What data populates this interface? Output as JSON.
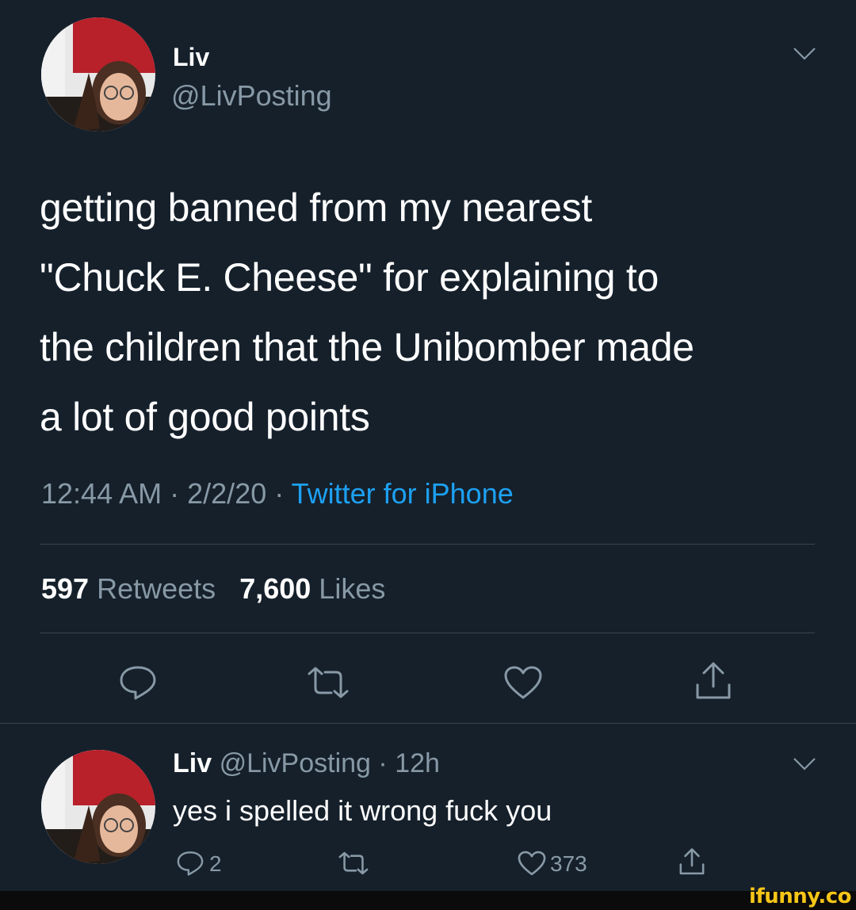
{
  "tweet": {
    "display_name": "Liv",
    "handle": "@LivPosting",
    "text_lines": [
      "getting banned from my nearest",
      "\"Chuck E. Cheese\" for explaining to",
      "the children that the Unibomber made",
      "a lot of good points"
    ],
    "time": "12:44 AM",
    "date": "2/2/20",
    "separator": "·",
    "source": "Twitter for iPhone",
    "retweets_count": "597",
    "retweets_label": "Retweets",
    "likes_count": "7,600",
    "likes_label": "Likes"
  },
  "reply": {
    "display_name": "Liv",
    "handle": "@LivPosting",
    "age": "· 12h",
    "text": "yes i spelled it wrong fuck you",
    "reply_count": "2",
    "like_count": "373"
  },
  "icons": [
    "chevron-down-icon",
    "reply-icon",
    "retweet-icon",
    "like-icon",
    "share-icon"
  ],
  "watermark": "ifunny.co",
  "colors": {
    "background": "#15202b",
    "muted": "#8899a6",
    "link": "#1da1f2",
    "divider": "#38444d"
  }
}
